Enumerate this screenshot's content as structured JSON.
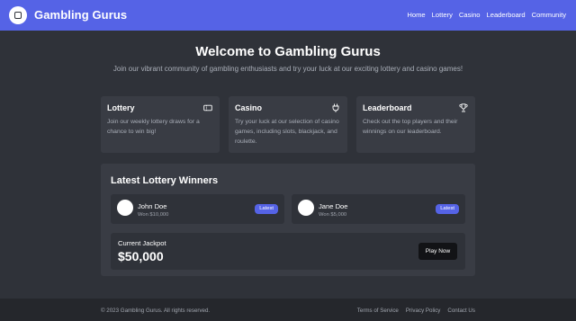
{
  "header": {
    "brand": "Gambling Gurus",
    "nav": [
      "Home",
      "Lottery",
      "Casino",
      "Leaderboard",
      "Community"
    ]
  },
  "hero": {
    "title": "Welcome to Gambling Gurus",
    "subtitle": "Join our vibrant community of gambling enthusiasts and try your luck at our exciting lottery and casino games!"
  },
  "cards": [
    {
      "title": "Lottery",
      "icon": "ticket-icon",
      "description": "Join our weekly lottery draws for a chance to win big!"
    },
    {
      "title": "Casino",
      "icon": "plug-icon",
      "description": "Try your luck at our selection of casino games, including slots, blackjack, and roulette."
    },
    {
      "title": "Leaderboard",
      "icon": "trophy-icon",
      "description": "Check out the top players and their winnings on our leaderboard."
    }
  ],
  "winners": {
    "title": "Latest Lottery Winners",
    "items": [
      {
        "name": "John Doe",
        "amount": "Won $10,000",
        "badge": "Latest"
      },
      {
        "name": "Jane Doe",
        "amount": "Won $5,000",
        "badge": "Latest"
      }
    ],
    "jackpot_label": "Current Jackpot",
    "jackpot_amount": "$50,000",
    "play_button": "Play Now"
  },
  "footer": {
    "copyright": "© 2023 Gambling Gurus. All rights reserved.",
    "links": [
      "Terms of Service",
      "Privacy Policy",
      "Contact Us"
    ]
  },
  "colors": {
    "accent": "#5563e6",
    "background": "#2f3239",
    "card": "#393c44",
    "footer": "#25272c"
  }
}
